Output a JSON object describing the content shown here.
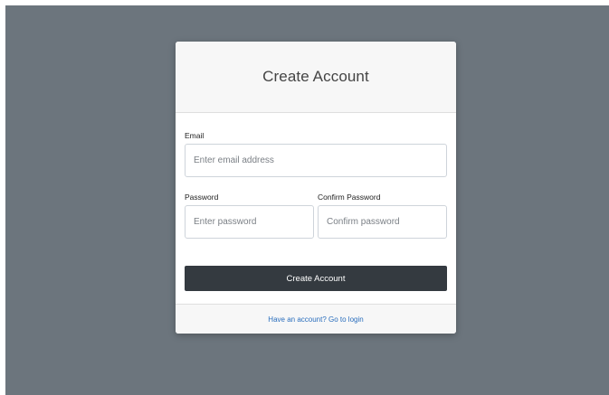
{
  "card": {
    "title": "Create Account"
  },
  "form": {
    "email": {
      "label": "Email",
      "placeholder": "Enter email address",
      "value": ""
    },
    "password": {
      "label": "Password",
      "placeholder": "Enter password",
      "value": ""
    },
    "confirm_password": {
      "label": "Confirm Password",
      "placeholder": "Confirm password",
      "value": ""
    },
    "submit_label": "Create Account"
  },
  "footer": {
    "login_link": "Have an account? Go to login"
  },
  "colors": {
    "backdrop": "#6c757d",
    "button": "#343a40",
    "link": "#2a6ebd"
  }
}
